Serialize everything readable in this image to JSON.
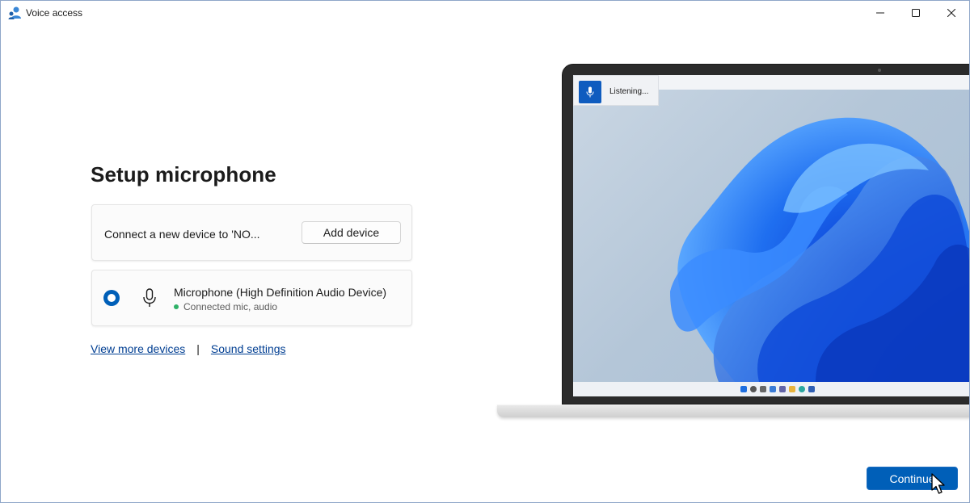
{
  "window": {
    "title": "Voice access",
    "controls": {
      "minimize": "minimize",
      "maximize": "maximize",
      "close": "close"
    }
  },
  "page": {
    "title": "Setup microphone"
  },
  "connect_card": {
    "text": "Connect a new device to 'NO...",
    "button_label": "Add device"
  },
  "mic_card": {
    "selected": true,
    "device_name": "Microphone (High Definition Audio Device)",
    "status": "Connected mic, audio",
    "status_color": "#2eb167"
  },
  "links": {
    "view_more": "View more devices",
    "separator": "|",
    "sound_settings": "Sound settings"
  },
  "illustration": {
    "listening_label": "Listening...",
    "accent": "#0f5cbf"
  },
  "footer": {
    "continue_label": "Continue",
    "accent": "#005fb8"
  },
  "icons": [
    "app-icon",
    "minimize-icon",
    "maximize-icon",
    "close-icon",
    "microphone-icon",
    "radio-selected-icon",
    "mouse-cursor-icon"
  ]
}
